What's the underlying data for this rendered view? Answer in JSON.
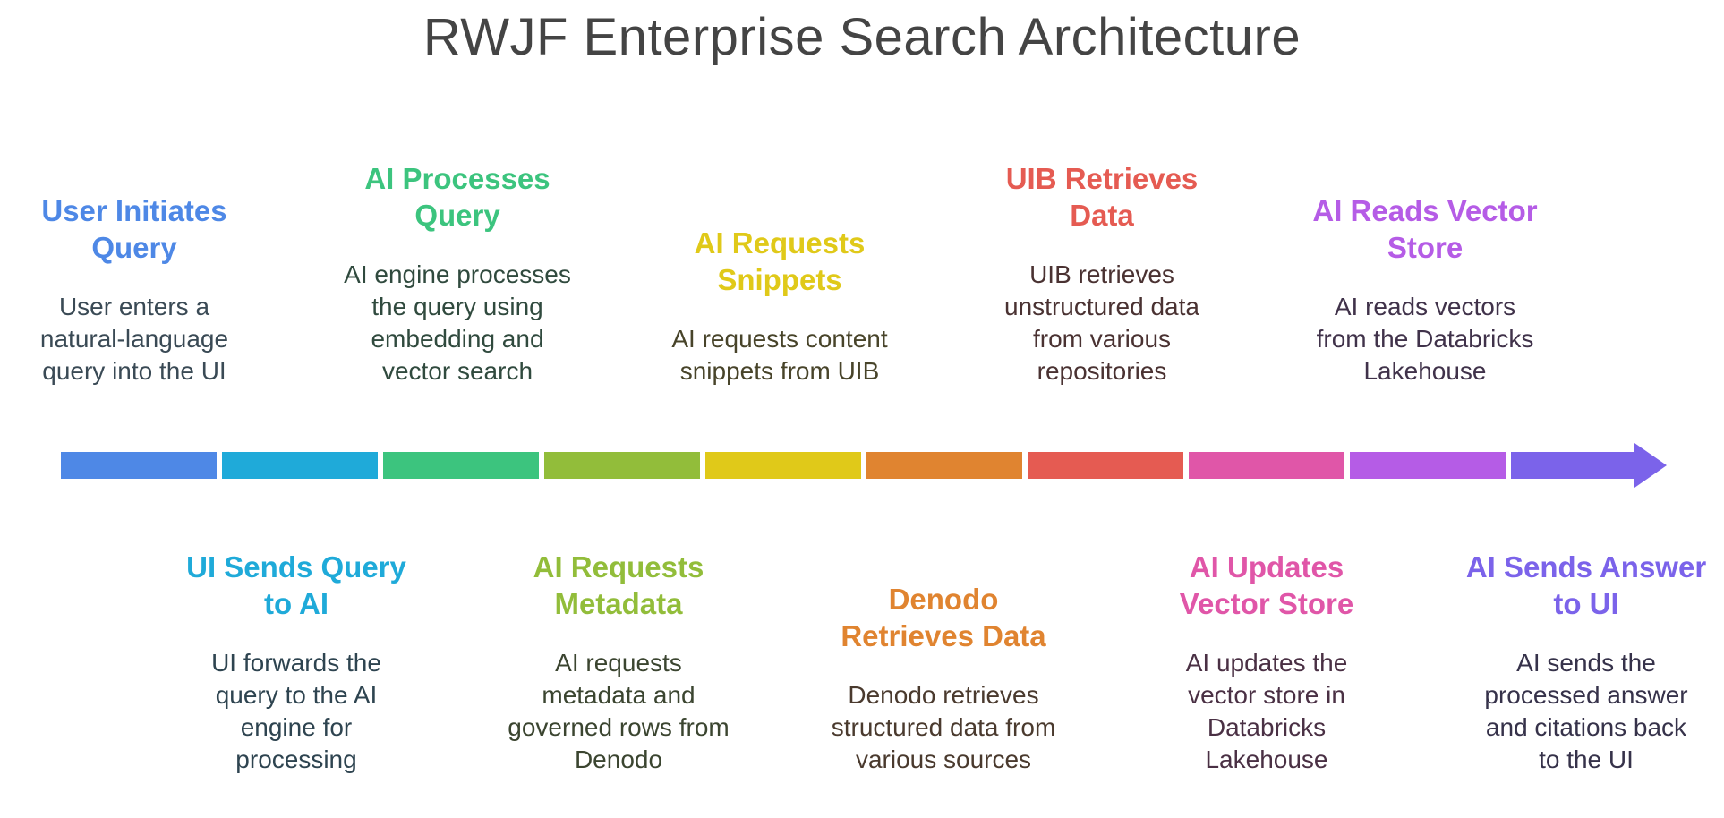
{
  "title": "RWJF Enterprise Search Architecture",
  "steps": [
    {
      "heading": "User Initiates\nQuery",
      "desc": "User enters a\nnatural-language\nquery into the UI",
      "color": "#4E88E6",
      "text_color": "#3A4A55"
    },
    {
      "heading": "UI Sends Query\nto AI",
      "desc": "UI forwards the\nquery to the AI\nengine for\nprocessing",
      "color": "#1FAAD9",
      "text_color": "#2E4450"
    },
    {
      "heading": "AI Processes\nQuery",
      "desc": "AI engine processes\nthe query using\nembedding and\nvector search",
      "color": "#3CC47E",
      "text_color": "#304A3E"
    },
    {
      "heading": "AI Requests\nMetadata",
      "desc": "AI requests\nmetadata and\ngoverned rows from\nDenodo",
      "color": "#92BD3A",
      "text_color": "#3B4530"
    },
    {
      "heading": "AI Requests\nSnippets",
      "desc": "AI requests content\nsnippets from UIB",
      "color": "#E0C919",
      "text_color": "#48442A"
    },
    {
      "heading": "Denodo\nRetrieves Data",
      "desc": "Denodo retrieves\nstructured data from\nvarious sources",
      "color": "#E08430",
      "text_color": "#4A3A2E"
    },
    {
      "heading": "UIB Retrieves\nData",
      "desc": "UIB retrieves\nunstructured data\nfrom various\nrepositories",
      "color": "#E55B52",
      "text_color": "#4A3232"
    },
    {
      "heading": "AI Updates\nVector Store",
      "desc": "AI updates the\nvector store in\nDatabricks\nLakehouse",
      "color": "#E056A8",
      "text_color": "#4A3044"
    },
    {
      "heading": "AI Reads Vector\nStore",
      "desc": "AI reads vectors\nfrom the Databricks\nLakehouse",
      "color": "#B55CE6",
      "text_color": "#40324A"
    },
    {
      "heading": "AI Sends Answer\nto UI",
      "desc": "AI sends the\nprocessed answer\nand citations back\nto the UI",
      "color": "#7B63EA",
      "text_color": "#36324A"
    }
  ]
}
